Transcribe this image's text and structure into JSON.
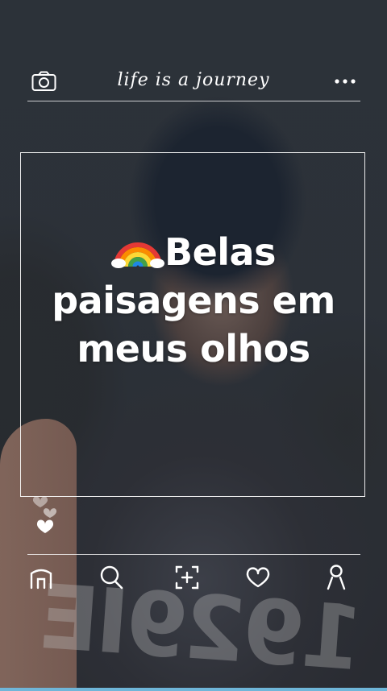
{
  "header": {
    "title": "life is a journey",
    "left_icon": "camera-icon",
    "right_icon": "more-icon"
  },
  "post": {
    "headline_emoji": "rainbow-icon",
    "headline_lines": [
      "Belas",
      "paisagens em",
      "meus olhos"
    ]
  },
  "background": {
    "shirt_print": "1929IE"
  },
  "reactions": {
    "icons": [
      "heart-icon",
      "heart-icon",
      "heart-icon"
    ]
  },
  "bottom_nav": {
    "items": [
      {
        "name": "home-icon"
      },
      {
        "name": "search-icon"
      },
      {
        "name": "add-post-icon"
      },
      {
        "name": "heart-icon"
      },
      {
        "name": "profile-icon"
      }
    ]
  },
  "colors": {
    "accent": "#ffffff",
    "sky": "#6fb6d9"
  }
}
